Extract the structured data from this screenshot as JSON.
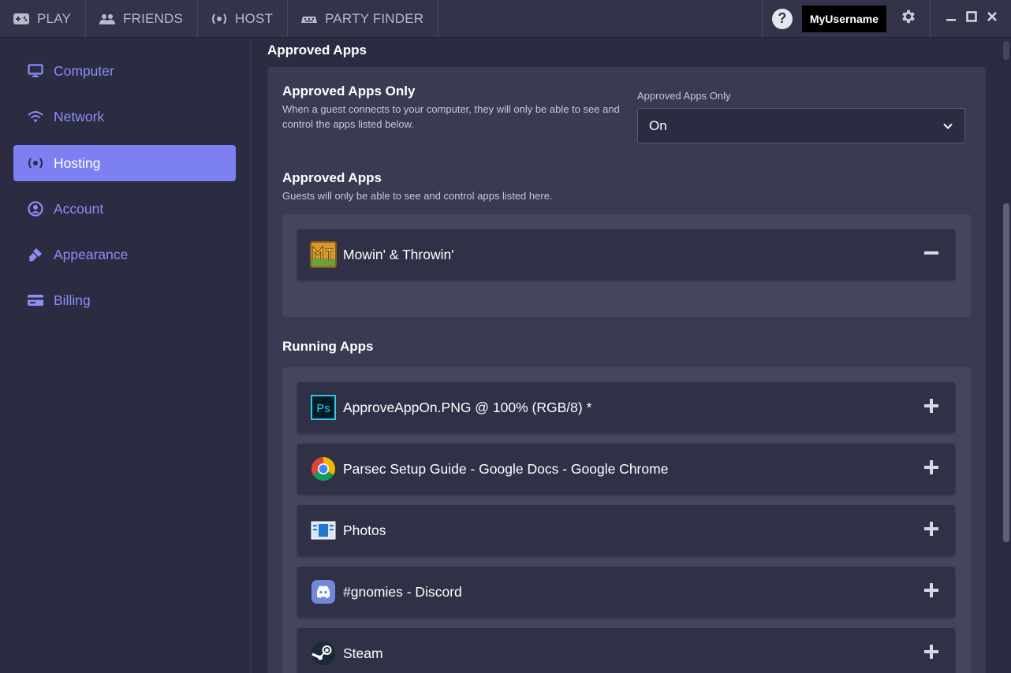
{
  "topbar": {
    "tabs": [
      {
        "label": "PLAY",
        "icon": "gamepad-icon"
      },
      {
        "label": "FRIENDS",
        "icon": "people-icon"
      },
      {
        "label": "HOST",
        "icon": "broadcast-icon"
      },
      {
        "label": "PARTY FINDER",
        "icon": "keyboard-icon"
      }
    ],
    "help_label": "?",
    "username": "MyUsername"
  },
  "sidebar": {
    "items": [
      {
        "label": "Computer",
        "icon": "monitor-icon",
        "active": false
      },
      {
        "label": "Network",
        "icon": "wifi-icon",
        "active": false
      },
      {
        "label": "Hosting",
        "icon": "broadcast-icon",
        "active": true
      },
      {
        "label": "Account",
        "icon": "account-icon",
        "active": false
      },
      {
        "label": "Appearance",
        "icon": "brush-icon",
        "active": false
      },
      {
        "label": "Billing",
        "icon": "credit-card-icon",
        "active": false
      }
    ]
  },
  "main": {
    "title": "Approved Apps",
    "approved_only": {
      "title": "Approved Apps Only",
      "description": "When a guest connects to your computer, they will only be able to see and control the apps listed below.",
      "select_label": "Approved Apps Only",
      "select_value": "On"
    },
    "approved_apps": {
      "title": "Approved Apps",
      "description": "Guests will only be able to see and control apps listed here.",
      "items": [
        {
          "name": "Mowin' & Throwin'",
          "icon": "mowin-throwin-icon"
        }
      ]
    },
    "running_apps": {
      "title": "Running Apps",
      "items": [
        {
          "name": "ApproveAppOn.PNG @ 100% (RGB/8) *",
          "icon": "photoshop-icon"
        },
        {
          "name": "Parsec Setup Guide - Google Docs - Google Chrome",
          "icon": "chrome-icon"
        },
        {
          "name": "Photos",
          "icon": "photos-icon"
        },
        {
          "name": "#gnomies - Discord",
          "icon": "discord-icon"
        },
        {
          "name": "Steam",
          "icon": "steam-icon"
        }
      ]
    }
  },
  "colors": {
    "accent": "#7c80f1",
    "nav_text": "#8b8ff6",
    "background": "#2b2b42",
    "panel": "#3a3a52"
  }
}
